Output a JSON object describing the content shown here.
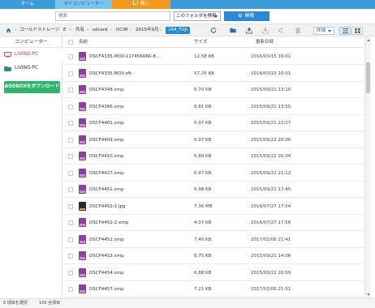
{
  "tabs": {
    "home": "ホーム",
    "my_computer": "マイコンピューター",
    "buy": "購入"
  },
  "search": {
    "placeholder": "検索",
    "scope": "このフォルダを検索",
    "button": "検索"
  },
  "breadcrumb": {
    "items": [
      "コールドストレージ",
      "E",
      "共有",
      "sdcard",
      "DCIM",
      "2015年9月"
    ],
    "current": "264_FUJI"
  },
  "toolbar": {
    "detail_label": "詳細"
  },
  "sidebar": {
    "title": "コンピューター",
    "items": [
      {
        "label": "LIVING-PC",
        "selected": true
      },
      {
        "label": "LIVING-PC",
        "selected": false
      }
    ],
    "download_button": "AOSBOXをダウンロード"
  },
  "list": {
    "columns": {
      "name": "名前",
      "size": "サイズ",
      "modified": "更新日時"
    },
    "rows": [
      {
        "name": "DSCF4335.MOV-117456666-8...",
        "size": "12.58 KB",
        "date": "2016/03/15 16:01",
        "type": "doc"
      },
      {
        "name": "DSCF4335.MOV.sfk",
        "size": "57.25 KB",
        "date": "2016/03/15 16:01",
        "type": "doc"
      },
      {
        "name": "DSCF4348.xmp",
        "size": "6.70 KB",
        "date": "2015/09/21 13:10",
        "type": "doc"
      },
      {
        "name": "DSCF4366.xmp",
        "size": "6.81 KB",
        "date": "2015/09/21 13:55",
        "type": "doc"
      },
      {
        "name": "DSCF4401.xmp",
        "size": "6.97 KB",
        "date": "2015/09/21 22:07",
        "type": "doc"
      },
      {
        "name": "DSCF4409.xmp",
        "size": "6.97 KB",
        "date": "2015/09/22 20:30",
        "type": "doc"
      },
      {
        "name": "DSCF4410.xmp",
        "size": "6.80 KB",
        "date": "2015/09/22 20:34",
        "type": "doc"
      },
      {
        "name": "DSCF4427.xmp",
        "size": "6.97 KB",
        "date": "2015/09/22 21:12",
        "type": "doc"
      },
      {
        "name": "DSCF4451.xmp",
        "size": "6.98 KB",
        "date": "2015/09/21 17:45",
        "type": "doc"
      },
      {
        "name": "DSCF4452-2.jpg",
        "size": "7.36 MB",
        "date": "2016/07/27 17:54",
        "type": "img"
      },
      {
        "name": "DSCF4452-2.xmp",
        "size": "4.07 KB",
        "date": "2016/07/27 17:56",
        "type": "doc"
      },
      {
        "name": "DSCF4452.xmp",
        "size": "7.40 KB",
        "date": "2017/02/06 21:41",
        "type": "doc"
      },
      {
        "name": "DSCF4453.xmp",
        "size": "6.75 KB",
        "date": "2015/09/21 14:06",
        "type": "doc"
      },
      {
        "name": "DSCF4454.xmp",
        "size": "6.88 KB",
        "date": "2015/09/22 20:59",
        "type": "doc"
      },
      {
        "name": "DSCF4457.xmp",
        "size": "7.21 KB",
        "date": "2017/02/06 21:51",
        "type": "doc"
      },
      {
        "name": "",
        "size": "",
        "date": "",
        "type": "doc"
      }
    ]
  },
  "status": {
    "selected": "0 項目を選択",
    "total": "100 全項目"
  },
  "colors": {
    "accent_blue": "#2a88d4",
    "tab_blue": "#3d9bd9",
    "buy_orange": "#f29a1e",
    "download_green": "#2fb46e",
    "selected_red": "#d9352a"
  }
}
